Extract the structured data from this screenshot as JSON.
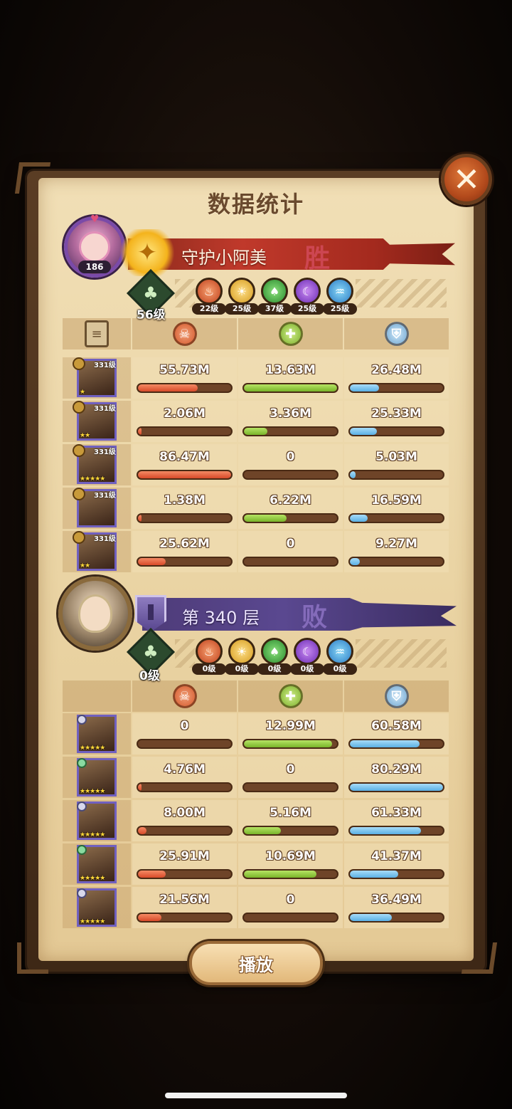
{
  "title": "数据统计",
  "play_label": "播放",
  "colors": {
    "damage": "#d84a2a",
    "heal": "#78b42a",
    "shield": "#5ab0e4",
    "win_banner": "#c0392b",
    "lose_banner": "#5a4890"
  },
  "attacker": {
    "avatar_level": "186",
    "name": "守护小阿美",
    "result": "胜",
    "resonance_level": "56级",
    "factions": [
      {
        "icon": "fire-faction-icon",
        "level": "22级"
      },
      {
        "icon": "light-faction-icon",
        "level": "25级"
      },
      {
        "icon": "forest-faction-icon",
        "level": "37级"
      },
      {
        "icon": "shadow-faction-icon",
        "level": "25级"
      },
      {
        "icon": "water-faction-icon",
        "level": "25级"
      }
    ],
    "heroes": [
      {
        "level": "331级",
        "stars": "★",
        "damage": "55.73M",
        "heal": "13.63M",
        "shield": "26.48M",
        "damage_ratio": 0.64,
        "heal_ratio": 1.0,
        "shield_ratio": 0.31
      },
      {
        "level": "331级",
        "stars": "★★",
        "damage": "2.06M",
        "heal": "3.36M",
        "shield": "25.33M",
        "damage_ratio": 0.02,
        "heal_ratio": 0.25,
        "shield_ratio": 0.29
      },
      {
        "level": "331级",
        "stars": "★★★★★",
        "damage": "86.47M",
        "heal": "0",
        "shield": "5.03M",
        "damage_ratio": 1.0,
        "heal_ratio": 0.0,
        "shield_ratio": 0.06
      },
      {
        "level": "331级",
        "stars": "",
        "damage": "1.38M",
        "heal": "6.22M",
        "shield": "16.59M",
        "damage_ratio": 0.02,
        "heal_ratio": 0.46,
        "shield_ratio": 0.19
      },
      {
        "level": "331级",
        "stars": "★★",
        "damage": "25.62M",
        "heal": "0",
        "shield": "9.27M",
        "damage_ratio": 0.3,
        "heal_ratio": 0.0,
        "shield_ratio": 0.11
      }
    ]
  },
  "defender": {
    "name": "第 340 层",
    "result": "败",
    "resonance_level": "0级",
    "factions": [
      {
        "icon": "fire-faction-icon",
        "level": "0级"
      },
      {
        "icon": "light-faction-icon",
        "level": "0级"
      },
      {
        "icon": "forest-faction-icon",
        "level": "0级"
      },
      {
        "icon": "shadow-faction-icon",
        "level": "0级"
      },
      {
        "icon": "water-faction-icon",
        "level": "0级"
      }
    ],
    "heroes": [
      {
        "medal": "silver",
        "stars": "★★★★★",
        "damage": "0",
        "heal": "12.99M",
        "shield": "60.58M",
        "damage_ratio": 0.0,
        "heal_ratio": 0.95,
        "shield_ratio": 0.75
      },
      {
        "medal": "green",
        "stars": "★★★★★",
        "damage": "4.76M",
        "heal": "0",
        "shield": "80.29M",
        "damage_ratio": 0.03,
        "heal_ratio": 0.0,
        "shield_ratio": 1.0
      },
      {
        "medal": "silver",
        "stars": "★★★★★",
        "damage": "8.00M",
        "heal": "5.16M",
        "shield": "61.33M",
        "damage_ratio": 0.09,
        "heal_ratio": 0.4,
        "shield_ratio": 0.76
      },
      {
        "medal": "green",
        "stars": "★★★★★",
        "damage": "25.91M",
        "heal": "10.69M",
        "shield": "41.37M",
        "damage_ratio": 0.3,
        "heal_ratio": 0.78,
        "shield_ratio": 0.52
      },
      {
        "medal": "silver",
        "stars": "★★★★★",
        "damage": "21.56M",
        "heal": "0",
        "shield": "36.49M",
        "damage_ratio": 0.25,
        "heal_ratio": 0.0,
        "shield_ratio": 0.45
      }
    ]
  }
}
